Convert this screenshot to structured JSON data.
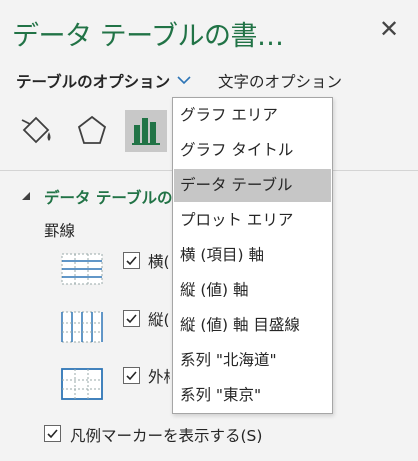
{
  "pane": {
    "title": "データ テーブルの書…",
    "close_icon": "close-icon"
  },
  "tabs": {
    "active_label": "テーブルのオプション",
    "other_label": "文字のオプション"
  },
  "icons": {
    "fill": "paint-bucket-icon",
    "effects": "pentagon-icon",
    "series_options": "bar-chart-icon"
  },
  "section": {
    "title": "データ テーブルの",
    "border_label": "罫線"
  },
  "border_options": [
    {
      "label": "横(",
      "checked": true
    },
    {
      "label": "縦(",
      "checked": true
    },
    {
      "label": "外枠",
      "checked": true
    }
  ],
  "legend": {
    "label": "凡例マーカーを表示する(S)",
    "checked": true
  },
  "dropdown": {
    "items": [
      {
        "label": "グラフ エリア",
        "selected": false
      },
      {
        "label": "グラフ タイトル",
        "selected": false
      },
      {
        "label": "データ テーブル",
        "selected": true
      },
      {
        "label": "プロット エリア",
        "selected": false
      },
      {
        "label": "横 (項目) 軸",
        "selected": false
      },
      {
        "label": "縦 (値) 軸",
        "selected": false
      },
      {
        "label": "縦 (値) 軸 目盛線",
        "selected": false
      },
      {
        "label": "系列 \"北海道\"",
        "selected": false
      },
      {
        "label": "系列 \"東京\"",
        "selected": false
      }
    ]
  },
  "colors": {
    "accent_green": "#217346",
    "table_icon_blue": "#2e75b6",
    "selected_bg": "#c6c6c6"
  }
}
